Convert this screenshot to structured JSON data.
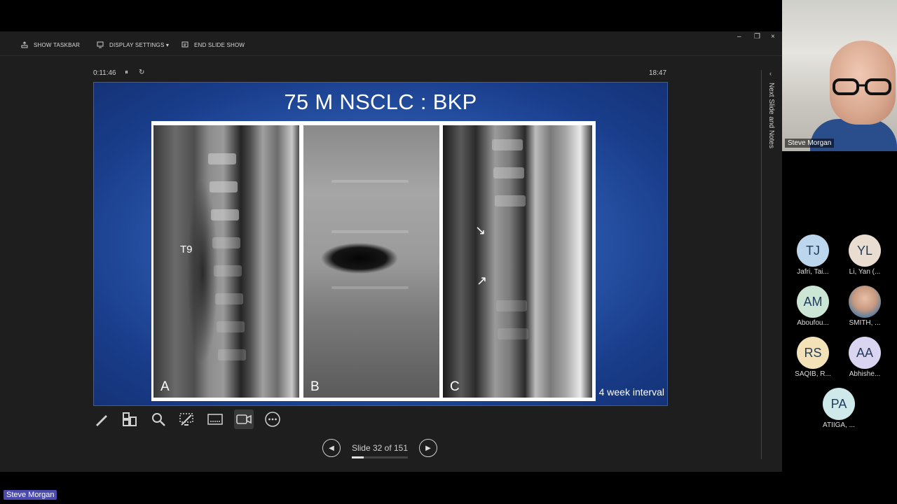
{
  "toolbar": {
    "show_taskbar": "SHOW TASKBAR",
    "display_settings": "DISPLAY SETTINGS ▾",
    "end_slide_show": "END SLIDE SHOW"
  },
  "window_controls": {
    "minimize": "–",
    "restore": "❐",
    "close": "×"
  },
  "timer": {
    "elapsed": "0:11:46",
    "pause": "⏸",
    "reset": "↻",
    "clock": "18:47"
  },
  "slide": {
    "title": "75 M NSCLC : BKP",
    "panels": {
      "a": "A",
      "b": "B",
      "c": "C"
    },
    "level_label": "T9",
    "interval_caption": "4 week interval"
  },
  "navigation": {
    "slide_counter": "Slide 32 of 151",
    "progress_fraction": 0.212,
    "prev": "◀",
    "next": "▶"
  },
  "side_panel": {
    "label": "Next Slide and Notes",
    "chevron": "‹"
  },
  "tools": [
    "pen-icon",
    "grid-icon",
    "zoom-icon",
    "pointer-icon",
    "subtitles-icon",
    "camera-icon",
    "more-icon"
  ],
  "meeting": {
    "active_speaker": "Steve Morgan",
    "participants": [
      {
        "initials": "TJ",
        "name": "Jafri, Tai...",
        "color": "#bcd6ee"
      },
      {
        "initials": "YL",
        "name": "Li, Yan (...",
        "color": "#e9ddd2"
      },
      {
        "initials": "AM",
        "name": "Aboufou...",
        "color": "#cce6d6"
      },
      {
        "initials": "",
        "name": "SMITH, ...",
        "color": "#8da6b8"
      },
      {
        "initials": "RS",
        "name": "SAQIB, R...",
        "color": "#f3e2b8"
      },
      {
        "initials": "AA",
        "name": "Abhishe...",
        "color": "#d9d5f0"
      },
      {
        "initials": "PA",
        "name": "ATIIGA, ...",
        "color": "#cfe8ea"
      }
    ],
    "bottom_name": "Steve Morgan"
  }
}
